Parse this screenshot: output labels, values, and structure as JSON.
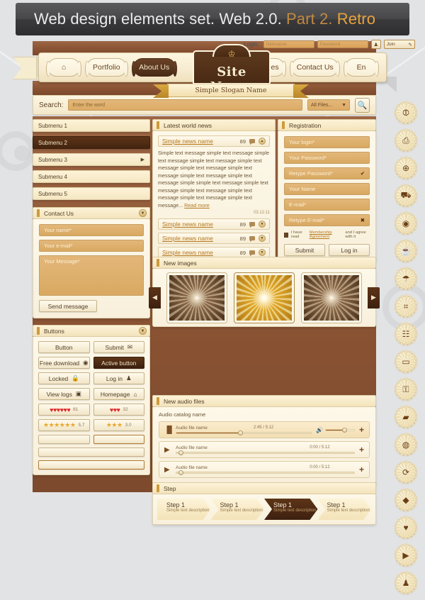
{
  "header": {
    "title_main": "Web design elements set. Web 2.0.",
    "title_part": "Part 2.",
    "title_retro": "Retro"
  },
  "login": {
    "label": "Login:",
    "nickname_placeholder": "Nickname",
    "password_placeholder": "Password",
    "user_icon": "user-icon",
    "join_label": "Join",
    "join_icon": "pencil-icon"
  },
  "nav": {
    "home_icon": "home-icon",
    "items": [
      {
        "label": "Portfolio",
        "active": false
      },
      {
        "label": "About Us",
        "active": true
      },
      {
        "label": "Services",
        "active": false
      },
      {
        "label": "Contact Us",
        "active": false
      },
      {
        "label": "En",
        "active": false
      }
    ]
  },
  "brand": {
    "site_name": "Site Name",
    "slogan": "Simple Slogan Name",
    "crown_icon": "crown-icon"
  },
  "search": {
    "label": "Search:",
    "placeholder": "Enter the word",
    "filter": "All Files...",
    "button_icon": "search-icon"
  },
  "sidebar": {
    "items": [
      {
        "label": "Submenu 1",
        "active": false,
        "has_arrow": false
      },
      {
        "label": "Submenu 2",
        "active": true,
        "has_arrow": false
      },
      {
        "label": "Submenu 3",
        "active": false,
        "has_arrow": true
      },
      {
        "label": "Submenu 4",
        "active": false,
        "has_arrow": false
      },
      {
        "label": "Submenu 5",
        "active": false,
        "has_arrow": false
      }
    ]
  },
  "contact": {
    "title": "Contact Us",
    "name_placeholder": "Your name*",
    "email_placeholder": "Your e-mail*",
    "message_placeholder": "Your Message*",
    "send_label": "Send message"
  },
  "buttons_panel": {
    "title": "Buttons",
    "rows": [
      {
        "left": {
          "label": "Button",
          "icon": "",
          "style": "normal"
        },
        "right": {
          "label": "Submit",
          "icon": "envelope-icon",
          "style": "normal"
        }
      },
      {
        "left": {
          "label": "Free download",
          "icon": "download-icon",
          "style": "normal"
        },
        "right": {
          "label": "Active button",
          "icon": "",
          "style": "dark"
        }
      },
      {
        "left": {
          "label": "Locked",
          "icon": "lock-icon",
          "style": "normal"
        },
        "right": {
          "label": "Log in",
          "icon": "user-icon",
          "style": "normal"
        }
      },
      {
        "left": {
          "label": "View logs",
          "icon": "list-icon",
          "style": "normal"
        },
        "right": {
          "label": "Homepage",
          "icon": "home-icon",
          "style": "normal"
        }
      }
    ],
    "ratings": [
      {
        "type": "heart",
        "filled": 6,
        "total": 6,
        "value": "81"
      },
      {
        "type": "heart",
        "filled": 3,
        "total": 3,
        "value": "32"
      },
      {
        "type": "star",
        "filled": 6,
        "total": 6,
        "value": "5.7"
      },
      {
        "type": "star",
        "filled": 3,
        "total": 3,
        "value": "3.0"
      }
    ]
  },
  "news": {
    "title": "Latest world news",
    "featured": {
      "headline": "Simple news name",
      "comments": "89",
      "body": "Simple text message simple  text message simple text message simple text message simple text message simple text message simple text message simple text message simple text message simple simple text message simple text message simple text message simple text message simple text message simple text message...",
      "read_more": "Read more",
      "date": "03.12.11"
    },
    "items": [
      {
        "headline": "Simple news name",
        "comments": "89"
      },
      {
        "headline": "Simple news name",
        "comments": "89"
      },
      {
        "headline": "Simple news name",
        "comments": "89"
      }
    ]
  },
  "registration": {
    "title": "Registration",
    "fields": [
      {
        "placeholder": "Your login*",
        "mark": ""
      },
      {
        "placeholder": "Your Password*",
        "mark": ""
      },
      {
        "placeholder": "Retype Password*",
        "mark": "✔"
      },
      {
        "placeholder": "Your Name",
        "mark": ""
      },
      {
        "placeholder": "E-mail*",
        "mark": ""
      },
      {
        "placeholder": "Retype E-mail*",
        "mark": "✖"
      }
    ],
    "agree_pre": "I have read",
    "agree_link": "Membership Agreement",
    "agree_post": "and I agree with it",
    "submit_label": "Submit",
    "login_label": "Log in"
  },
  "gallery": {
    "title": "New images",
    "prev_icon": "chevron-left-icon",
    "next_icon": "chevron-right-icon",
    "slides": [
      {
        "name": "starburst-brown",
        "active": false
      },
      {
        "name": "starburst-gold",
        "active": true
      },
      {
        "name": "starburst-brown",
        "active": false
      }
    ]
  },
  "audio": {
    "title": "New audio files",
    "catalog_name": "Audio catalog name",
    "volume_icon": "speaker-icon",
    "add_icon": "plus-icon",
    "tracks": [
      {
        "name": "Audio file name",
        "time": "2:45 / 5:12",
        "progress": 48,
        "state": "playing",
        "icon": "pause-icon"
      },
      {
        "name": "Audio file name",
        "time": "0:00 / 5:12",
        "progress": 2,
        "state": "stopped",
        "icon": "play-icon"
      },
      {
        "name": "Audio file name",
        "time": "0:00 / 5:12",
        "progress": 2,
        "state": "stopped",
        "icon": "play-icon"
      }
    ]
  },
  "steps": {
    "title": "Step",
    "items": [
      {
        "title": "Step 1",
        "desc": "Simple text description",
        "active": false
      },
      {
        "title": "Step 1",
        "desc": "Simple text description",
        "active": false
      },
      {
        "title": "Step 1",
        "desc": "Simple text description",
        "active": true
      },
      {
        "title": "Step 1",
        "desc": "Simple text description",
        "active": false
      }
    ]
  },
  "rail_icons": [
    {
      "name": "rss-icon",
      "glyph": "⦷"
    },
    {
      "name": "printer-icon",
      "glyph": "⎙"
    },
    {
      "name": "globe-icon",
      "glyph": "⊕"
    },
    {
      "name": "cart-icon",
      "glyph": "⛟"
    },
    {
      "name": "camera-icon",
      "glyph": "◉"
    },
    {
      "name": "coffee-icon",
      "glyph": "☕"
    },
    {
      "name": "umbrella-icon",
      "glyph": "☂"
    },
    {
      "name": "gamepad-icon",
      "glyph": "⌗"
    },
    {
      "name": "notepad-icon",
      "glyph": "☷"
    },
    {
      "name": "briefcase-icon",
      "glyph": "▭"
    },
    {
      "name": "lock-icon",
      "glyph": "⚿"
    },
    {
      "name": "folder-icon",
      "glyph": "▰"
    },
    {
      "name": "headphones-icon",
      "glyph": "◍"
    },
    {
      "name": "refresh-icon",
      "glyph": "⟳"
    },
    {
      "name": "tag-icon",
      "glyph": "◆"
    },
    {
      "name": "heart-icon",
      "glyph": "♥"
    },
    {
      "name": "video-icon",
      "glyph": "▶"
    },
    {
      "name": "person-icon",
      "glyph": "♟"
    }
  ],
  "colors": {
    "brand_brown": "#5d3518",
    "accent_gold": "#e8a33d",
    "panel_cream": "#fdf3d8",
    "field_tan": "#e3b77a",
    "wood": "#8b5434"
  }
}
